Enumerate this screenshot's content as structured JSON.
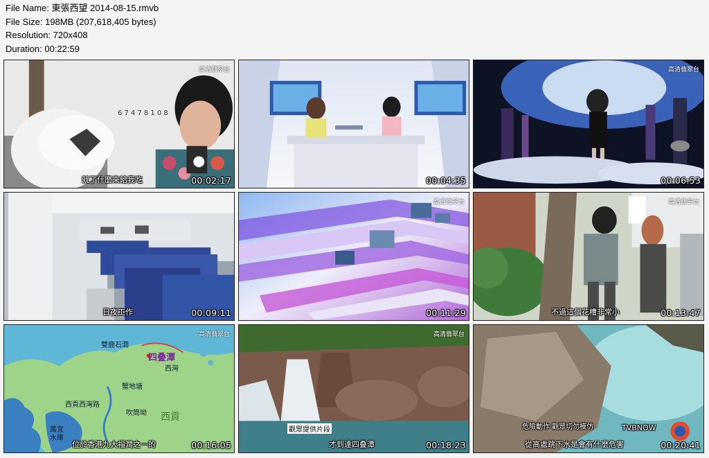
{
  "header": {
    "file_name_label": "File Name:",
    "file_name": "東張西望 2014-08-15.rmvb",
    "file_size_label": "File Size:",
    "file_size": "198MB (207,618,405 bytes)",
    "resolution_label": "Resolution:",
    "resolution": "720x408",
    "duration_label": "Duration:",
    "duration": "00:22:59"
  },
  "thumbnails": [
    {
      "time": "00:02:17",
      "subtitle": "就了什麼來給我吃",
      "logo": "高清翡翠台"
    },
    {
      "time": "00:04:35",
      "subtitle": "",
      "logo": "高清翡翠台"
    },
    {
      "time": "00:06:53",
      "subtitle": "",
      "logo": "高清翡翠台"
    },
    {
      "time": "00:09:11",
      "subtitle": "日夜工作",
      "logo": ""
    },
    {
      "time": "00:11:29",
      "subtitle": "",
      "logo": "高清翡翠台"
    },
    {
      "time": "00:13:47",
      "subtitle": "不過這個花槽非常小",
      "logo": "高清翡翠台"
    },
    {
      "time": "00:16:05",
      "subtitle": "位於香港九大福澗之一的",
      "logo": "高清翡翠台",
      "map_labels": [
        "雙鹿石澗",
        "四叠潭",
        "西灣",
        "蟹地塘",
        "西貢西灣路",
        "吹筒坳",
        "西貢",
        "萬宜",
        "水庫"
      ]
    },
    {
      "time": "00:18:23",
      "subtitle": "才到達四叠潭",
      "logo": "高清翡翠台",
      "caption": "觀眾提供片段"
    },
    {
      "time": "00:20:41",
      "subtitle": "從高處跳下水是會有什麼危害",
      "logo": "",
      "caption": "危險動作 觀眾切勿模仿",
      "watermark": "TVBNOW"
    }
  ]
}
